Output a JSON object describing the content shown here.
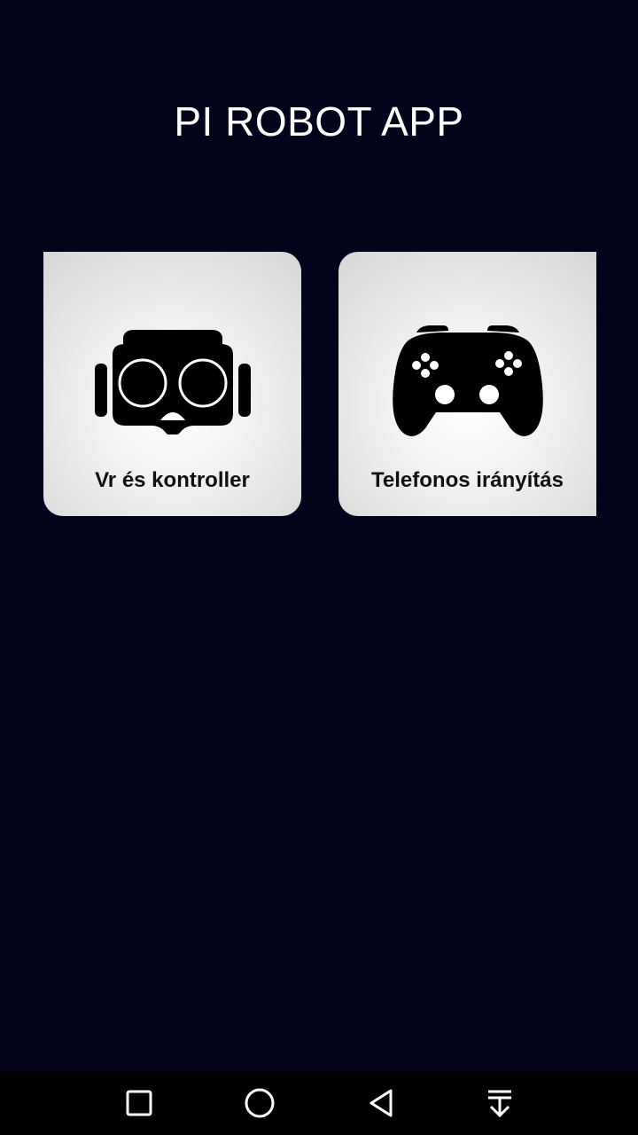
{
  "app": {
    "title": "PI ROBOT APP"
  },
  "cards": [
    {
      "label": "Vr és kontroller",
      "icon": "vr-headset-icon"
    },
    {
      "label": "Telefonos irányítás",
      "icon": "gamepad-icon"
    }
  ],
  "navbar": {
    "buttons": [
      "recents-square-icon",
      "home-circle-icon",
      "back-triangle-icon",
      "notification-pulldown-icon"
    ]
  },
  "colors": {
    "background": "#04031c",
    "card_bg": "#f3f3f3",
    "title_text": "#ffffff",
    "label_text": "#111111"
  }
}
